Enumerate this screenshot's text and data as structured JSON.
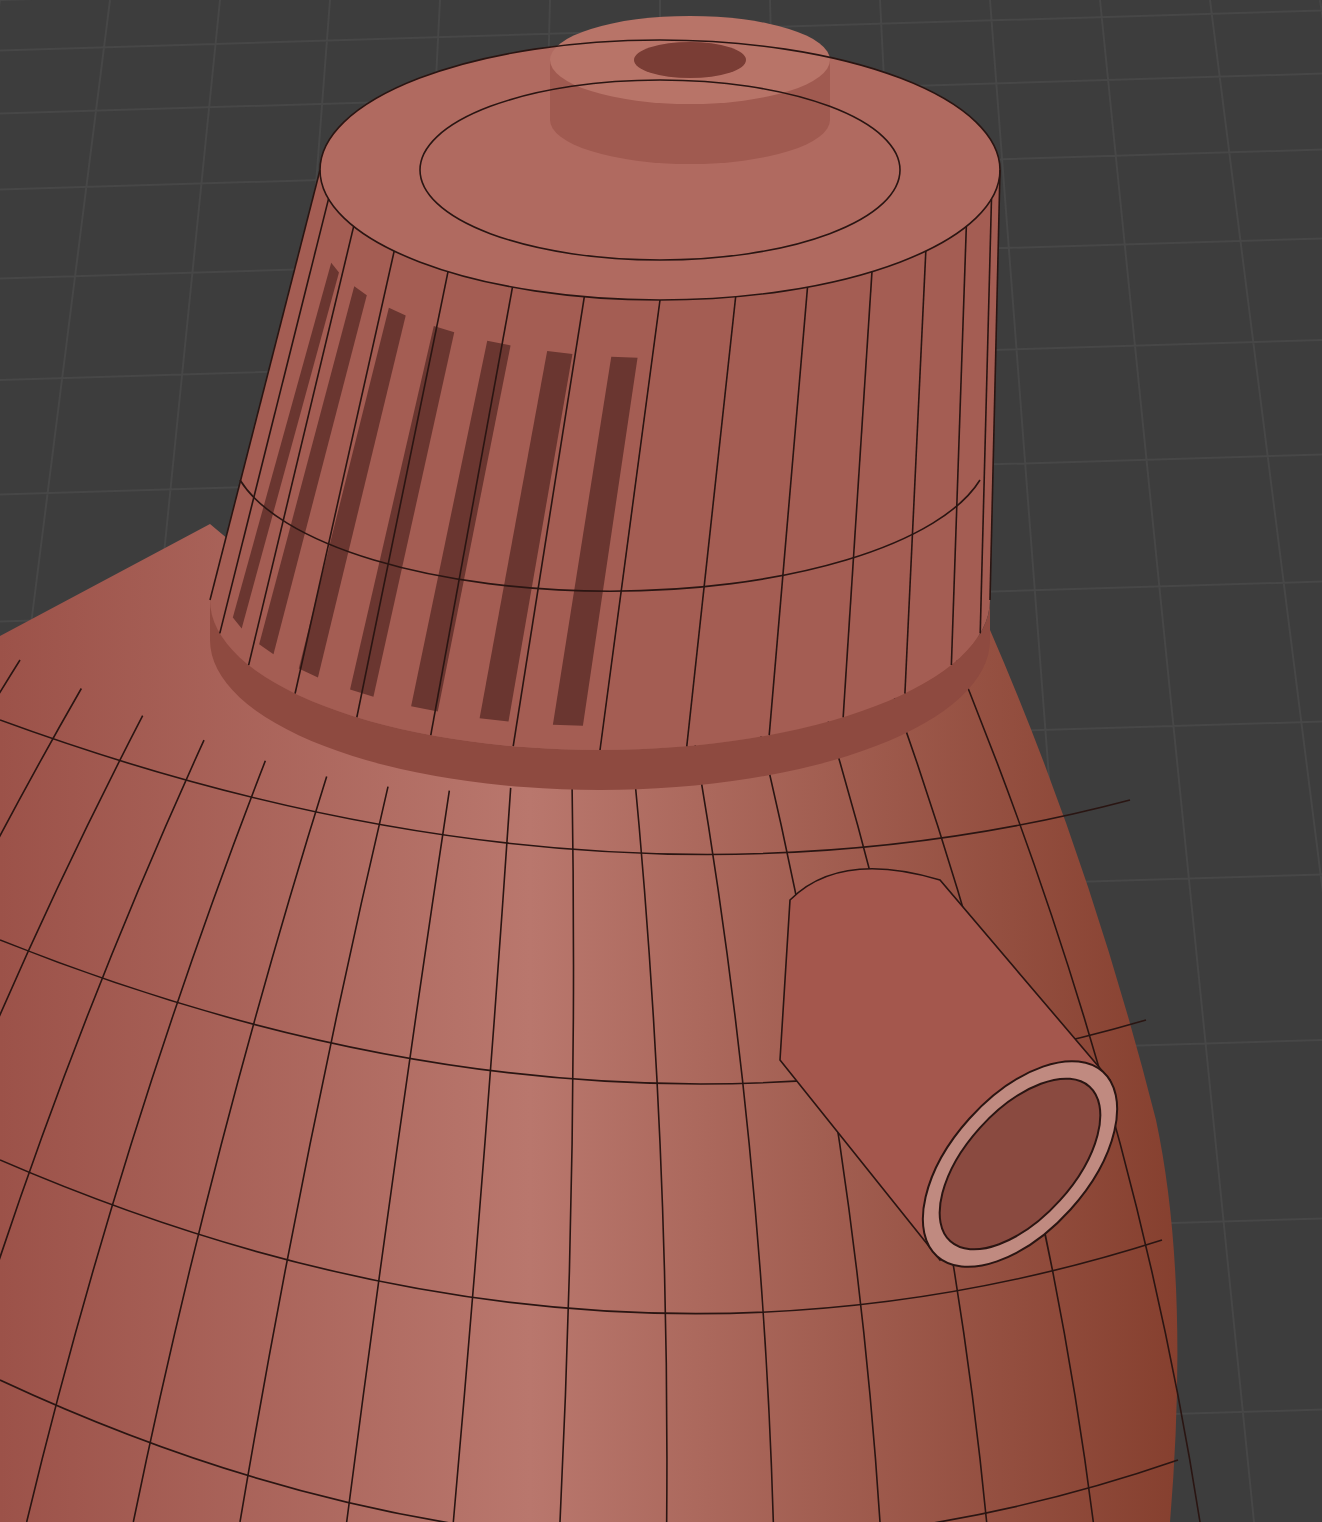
{
  "viewport": {
    "grid_visible": true,
    "wireframe_visible": true
  }
}
